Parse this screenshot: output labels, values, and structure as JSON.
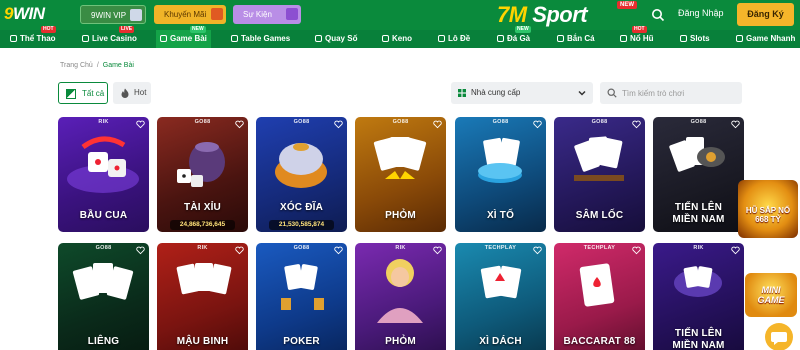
{
  "header": {
    "logo_prefix": "9",
    "logo_suffix": "WIN",
    "promos": [
      {
        "label": "9WIN VIP",
        "icon": "crown-icon"
      },
      {
        "label": "Khuyến Mãi",
        "icon": "gift-icon"
      },
      {
        "label": "Sự Kiện",
        "icon": "gift-box-icon"
      }
    ],
    "brand_prefix": "7M",
    "brand_suffix": "Sport",
    "brand_badge": "NEW",
    "login_label": "Đăng Nhập",
    "register_label": "Đăng Ký"
  },
  "nav": {
    "items": [
      {
        "label": "Thể Thao",
        "badge": "HOT"
      },
      {
        "label": "Live Casino",
        "badge": "LIVE"
      },
      {
        "label": "Game Bài",
        "badge": "NEW",
        "active": true
      },
      {
        "label": "Table Games",
        "badge": ""
      },
      {
        "label": "Quay Số",
        "badge": ""
      },
      {
        "label": "Keno",
        "badge": ""
      },
      {
        "label": "Lô Đề",
        "badge": ""
      },
      {
        "label": "Đá Gà",
        "badge": "NEW"
      },
      {
        "label": "Bắn Cá",
        "badge": ""
      },
      {
        "label": "Nổ Hũ",
        "badge": "HOT"
      },
      {
        "label": "Slots",
        "badge": ""
      },
      {
        "label": "Game Nhanh",
        "badge": ""
      }
    ]
  },
  "breadcrumb": {
    "home": "Trang Chủ",
    "sep": "/",
    "current": "Game Bài"
  },
  "filters": {
    "all_label": "Tất cả",
    "hot_label": "Hot",
    "provider_label": "Nhà cung cấp",
    "search_placeholder": "Tìm kiếm trò chơi"
  },
  "games": [
    {
      "title": "BẦU CUA",
      "provider": "RIK",
      "jackpot": ""
    },
    {
      "title": "TÀI XỈU",
      "provider": "GO88",
      "jackpot": "24,868,736,645"
    },
    {
      "title": "XÓC ĐĨA",
      "provider": "GO88",
      "jackpot": "21,530,585,874"
    },
    {
      "title": "PHỎM",
      "provider": "GO88",
      "jackpot": ""
    },
    {
      "title": "XÌ TỐ",
      "provider": "GO88",
      "jackpot": ""
    },
    {
      "title": "SÂM LỐC",
      "provider": "GO88",
      "jackpot": ""
    },
    {
      "title_line1": "TIẾN LÊN",
      "title_line2": "MIỀN NAM",
      "provider": "GO88",
      "jackpot": ""
    },
    {
      "title": "LIÊNG",
      "provider": "GO88",
      "jackpot": ""
    },
    {
      "title": "MẬU BINH",
      "provider": "RIK",
      "jackpot": ""
    },
    {
      "title": "POKER",
      "provider": "GO88",
      "jackpot": ""
    },
    {
      "title": "PHỎM",
      "provider": "RIK",
      "jackpot": ""
    },
    {
      "title": "XÌ DÁCH",
      "provider": "TECHPLAY",
      "jackpot": ""
    },
    {
      "title": "BACCARAT 88",
      "provider": "TECHPLAY",
      "jackpot": ""
    },
    {
      "title_line1": "TIẾN LÊN",
      "title_line2": "MIỀN NAM",
      "provider": "RIK",
      "jackpot": ""
    }
  ],
  "side": {
    "jackpot_badge_line1": "HŨ SẮP NỔ",
    "jackpot_badge_line2": "668 TỶ",
    "mini_game_line1": "MINI",
    "mini_game_line2": "GAME"
  },
  "colors": {
    "primary": "#0a8a3c",
    "accent": "#f5b52a",
    "hot": "#e62e2e"
  }
}
